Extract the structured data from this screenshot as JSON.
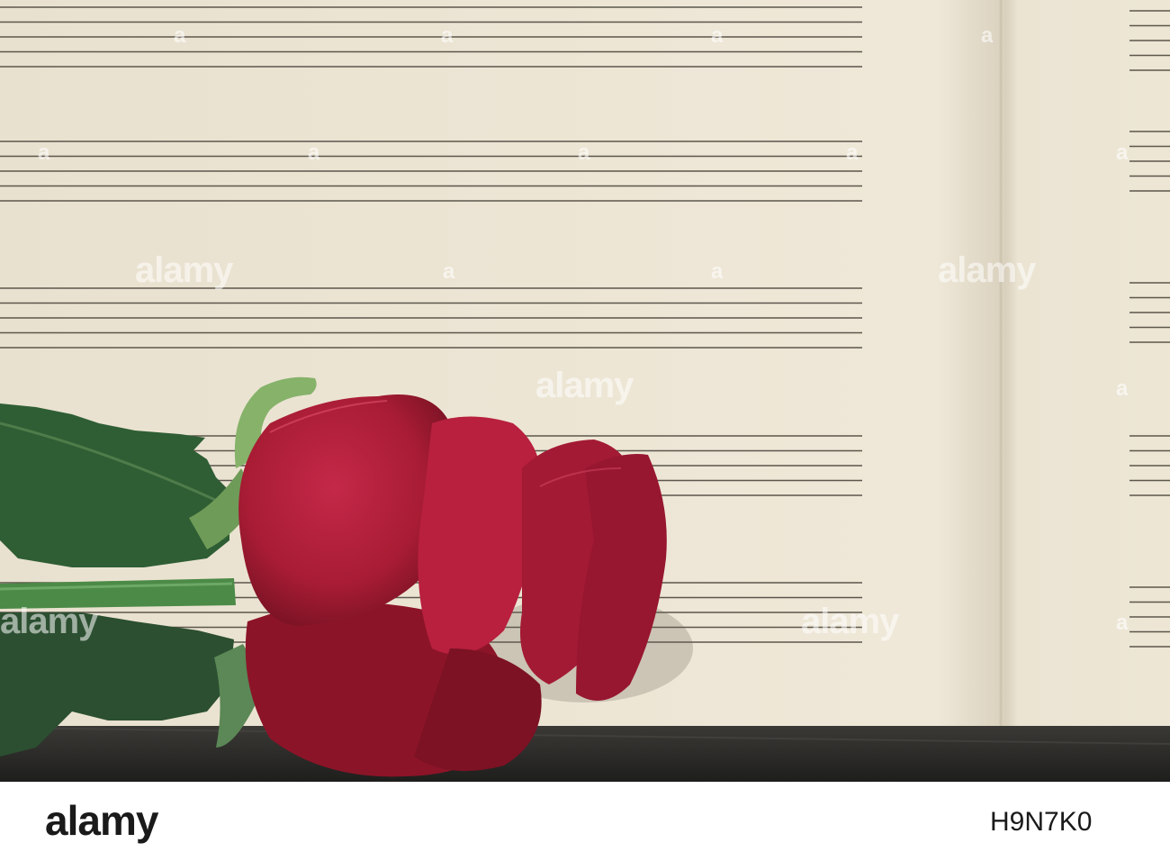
{
  "photo": {
    "subject": "red-rose-on-blank-sheet-music",
    "colors": {
      "paper": "#ece4d2",
      "staff_line": "#5c564c",
      "rose": "#b01e3a",
      "leaf": "#2f5e34",
      "table": "#2a2a28"
    }
  },
  "watermark": {
    "word": "alamy",
    "mark": "a"
  },
  "footer": {
    "logo": "alamy",
    "image_id": "H9N7K0"
  }
}
